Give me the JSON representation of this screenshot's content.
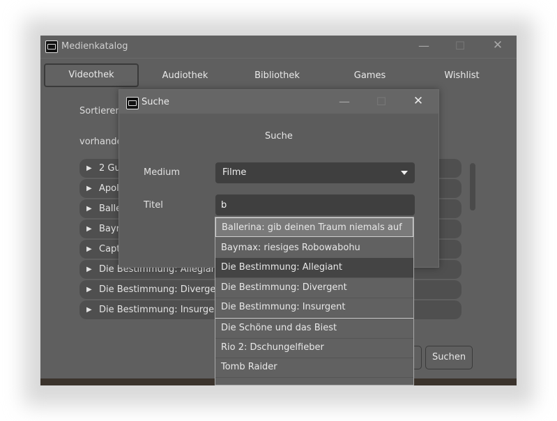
{
  "main_window": {
    "title": "Medienkatalog",
    "minimize": "—",
    "maximize": "☐",
    "close": "✕"
  },
  "tabs": [
    {
      "label": "Videothek",
      "active": true
    },
    {
      "label": "Audiothek",
      "active": false
    },
    {
      "label": "Bibliothek",
      "active": false
    },
    {
      "label": "Games",
      "active": false
    },
    {
      "label": "Wishlist",
      "active": false
    }
  ],
  "background": {
    "sort_label": "Sortieren",
    "available_label": "vorhande",
    "items": [
      "2 Gu",
      "Apol",
      "Balle",
      "Bayn",
      "Capt",
      "Die Bestimmung: Allegiant",
      "Die Bestimmung: Divergent",
      "Die Bestimmung: Insurgent"
    ],
    "search_button": "Suchen"
  },
  "dialog": {
    "title": "Suche",
    "heading": "Suche",
    "medium_label": "Medium",
    "medium_value": "Filme",
    "title_label": "Titel",
    "title_input_value": "b",
    "minimize": "—",
    "maximize": "☐",
    "close": "✕"
  },
  "suggestions": [
    "Ballerina: gib deinen Traum niemals auf",
    "Baymax: riesiges Robowabohu",
    "Die Bestimmung: Allegiant",
    "Die Bestimmung: Divergent",
    "Die Bestimmung: Insurgent",
    "Die Schöne und das Biest",
    "Rio 2: Dschungelfieber",
    "Tomb Raider"
  ]
}
